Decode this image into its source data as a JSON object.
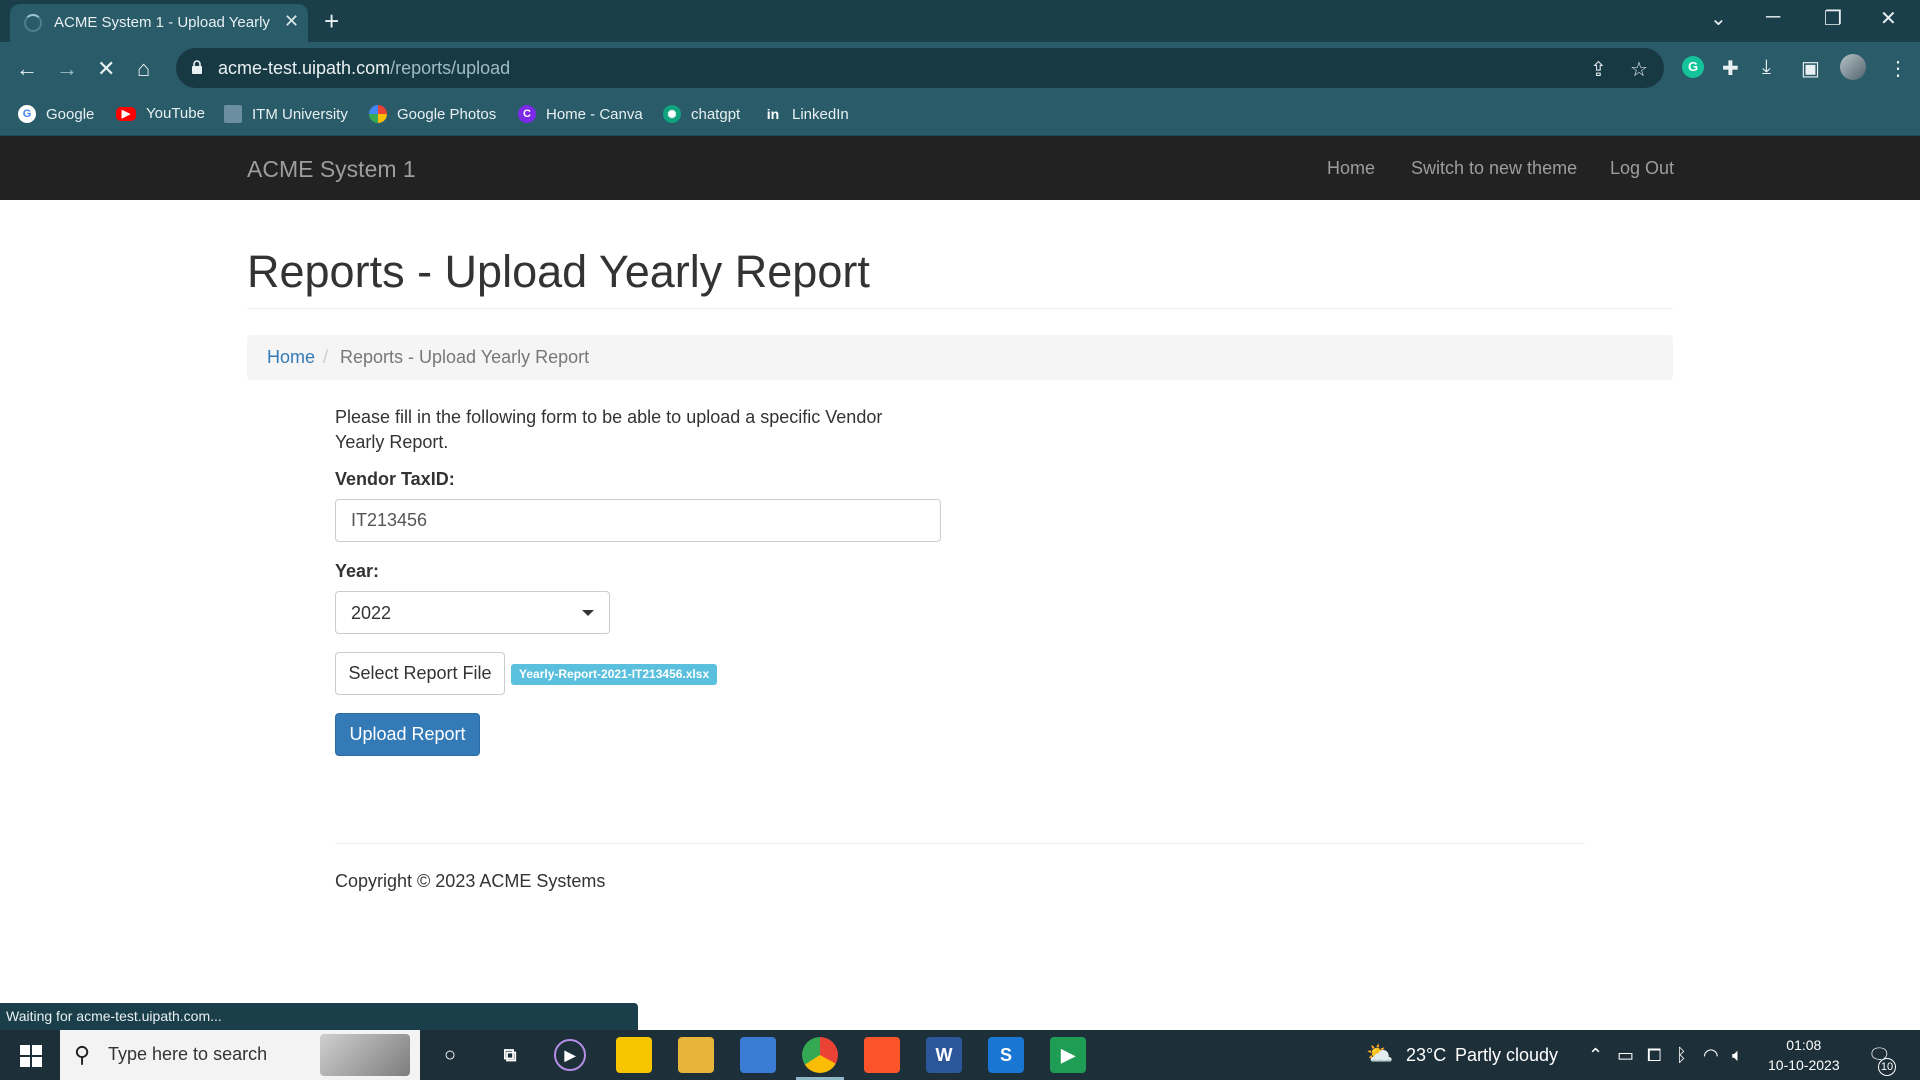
{
  "browser": {
    "tab_title": "ACME System 1 - Upload Yearly",
    "tab_close": "✕",
    "new_tab": "+",
    "url_host": "acme-test.uipath.com",
    "url_path": "/reports/upload",
    "bookmarks": [
      {
        "label": "Google",
        "color": "#ffffff"
      },
      {
        "label": "YouTube",
        "color": "#ff0000"
      },
      {
        "label": "ITM University",
        "color": "#6b8fa0"
      },
      {
        "label": "Google Photos",
        "color": "#f4b400"
      },
      {
        "label": "Home - Canva",
        "color": "#7d2ae8"
      },
      {
        "label": "chatgpt",
        "color": "#10a37f"
      },
      {
        "label": "LinkedIn",
        "color": "#0a66c2"
      }
    ],
    "status_text": "Waiting for acme-test.uipath.com..."
  },
  "app": {
    "brand": "ACME System 1",
    "nav": {
      "home": "Home",
      "switch_theme": "Switch to new theme",
      "logout": "Log Out"
    },
    "page_title": "Reports - Upload Yearly Report",
    "breadcrumb": {
      "home": "Home",
      "separator": "/",
      "current": "Reports - Upload Yearly Report"
    },
    "intro": "Please fill in the following form to be able to upload a specific Vendor Yearly Report.",
    "form": {
      "vendor_label": "Vendor TaxID:",
      "vendor_value": "IT213456",
      "year_label": "Year:",
      "year_value": "2022",
      "select_file_label": "Select Report File",
      "file_name": "Yearly-Report-2021-IT213456.xlsx",
      "upload_label": "Upload Report"
    },
    "copyright": "Copyright © 2023 ACME Systems"
  },
  "taskbar": {
    "search_placeholder": "Type here to search",
    "weather_temp": "23°C",
    "weather_desc": "Partly cloudy",
    "time": "01:08",
    "date": "10-10-2023",
    "notification_count": "10"
  }
}
